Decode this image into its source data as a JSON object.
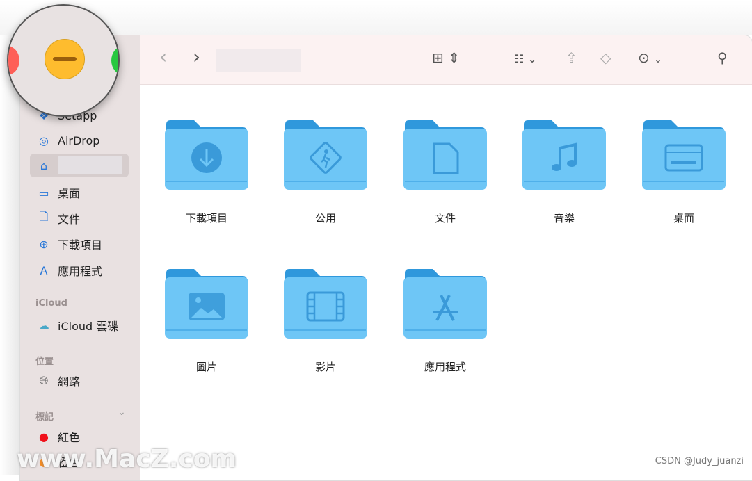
{
  "toolbar": {
    "back": "‹",
    "forward": "›",
    "view_icon": "grid-view-icon",
    "group_icon": "group-icon",
    "share_icon": "share-icon",
    "tag_icon": "tag-icon",
    "more_icon": "ellipsis-circle-icon",
    "search_icon": "search-icon"
  },
  "sidebar": {
    "items": [
      {
        "label": "Setapp",
        "icon": "setapp-icon"
      },
      {
        "label": "AirDrop",
        "icon": "airdrop-icon"
      },
      {
        "label": "",
        "icon": "home-icon"
      },
      {
        "label": "桌面",
        "icon": "desktop-icon"
      },
      {
        "label": "文件",
        "icon": "document-icon"
      },
      {
        "label": "下載項目",
        "icon": "download-icon"
      },
      {
        "label": "應用程式",
        "icon": "apps-icon"
      }
    ],
    "icloud_header": "iCloud",
    "icloud_drive": "iCloud 雲碟",
    "locations_header": "位置",
    "network": "網路",
    "tags_header": "標記",
    "tags": [
      {
        "label": "紅色",
        "color": "#f0101a"
      },
      {
        "label": "橙色",
        "color": "#f58a1f"
      }
    ]
  },
  "folders": [
    {
      "label": "下載項目",
      "icon": "download"
    },
    {
      "label": "公用",
      "icon": "public"
    },
    {
      "label": "文件",
      "icon": "document"
    },
    {
      "label": "音樂",
      "icon": "music"
    },
    {
      "label": "桌面",
      "icon": "desktop"
    },
    {
      "label": "圖片",
      "icon": "picture"
    },
    {
      "label": "影片",
      "icon": "movie"
    },
    {
      "label": "應用程式",
      "icon": "apps"
    }
  ],
  "colors": {
    "folder_back": "#2f98dc",
    "folder_front": "#6ec6f6",
    "close": "#fe5f57",
    "minimize": "#febc2e",
    "zoom": "#28c840"
  },
  "watermark": "www.MacZ.com",
  "credit": "CSDN @Judy_juanzi"
}
